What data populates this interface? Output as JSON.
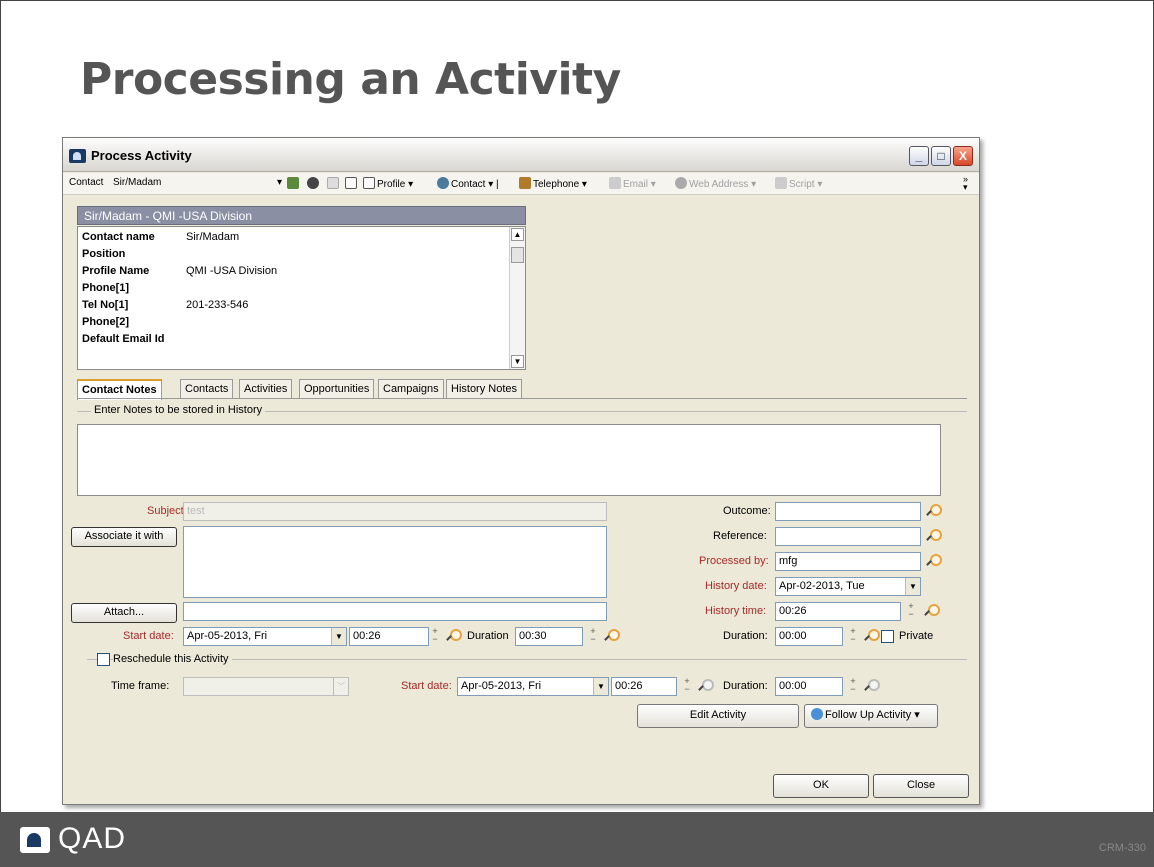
{
  "slide": {
    "title": "Processing an Activity",
    "logo_text": "QAD",
    "slide_code": "CRM-330"
  },
  "window": {
    "title": "Process Activity",
    "buttons": {
      "minimize": "_",
      "maximize": "□",
      "close": "X"
    }
  },
  "toolbar": {
    "contact_label": "Contact",
    "contact_value": "Sir/Madam",
    "profile": "Profile",
    "contact_menu": "Contact",
    "telephone": "Telephone",
    "email": "Email",
    "web_address": "Web Address",
    "script": "Script"
  },
  "contact_header": "Sir/Madam - QMI -USA Division",
  "info": [
    {
      "label": "Contact name",
      "value": "Sir/Madam"
    },
    {
      "label": "Position",
      "value": ""
    },
    {
      "label": "Profile Name",
      "value": "QMI -USA Division"
    },
    {
      "label": "Phone[1]",
      "value": ""
    },
    {
      "label": "Tel No[1]",
      "value": "201-233-546"
    },
    {
      "label": "Phone[2]",
      "value": ""
    },
    {
      "label": "Default Email Id",
      "value": ""
    }
  ],
  "tabs": [
    "Contact Notes",
    "Contacts",
    "Activities",
    "Opportunities",
    "Campaigns",
    "History Notes"
  ],
  "notes_group_label": "Enter Notes to be stored in History",
  "form": {
    "subject_label": "Subject:",
    "subject_value": "test",
    "associate_button": "Associate it with",
    "attach_button": "Attach...",
    "start_date_label": "Start date:",
    "start_date": "Apr-05-2013,  Fri",
    "start_time": "00:26",
    "duration_label": "Duration",
    "duration": "00:30",
    "outcome_label": "Outcome:",
    "reference_label": "Reference:",
    "processed_by_label": "Processed by:",
    "processed_by": "mfg",
    "history_date_label": "History date:",
    "history_date": "Apr-02-2013, Tue",
    "history_time_label": "History time:",
    "history_time": "00:26",
    "right_duration_label": "Duration:",
    "right_duration": "00:00",
    "private_label": "Private",
    "reschedule_label": "Reschedule this Activity",
    "time_frame_label": "Time frame:",
    "resched_start_label": "Start date:",
    "resched_start_date": "Apr-05-2013,  Fri",
    "resched_time": "00:26",
    "resched_duration_label": "Duration:",
    "resched_duration": "00:00",
    "edit_button": "Edit Activity",
    "follow_up_button": "Follow Up Activity",
    "ok_button": "OK",
    "close_button": "Close"
  }
}
